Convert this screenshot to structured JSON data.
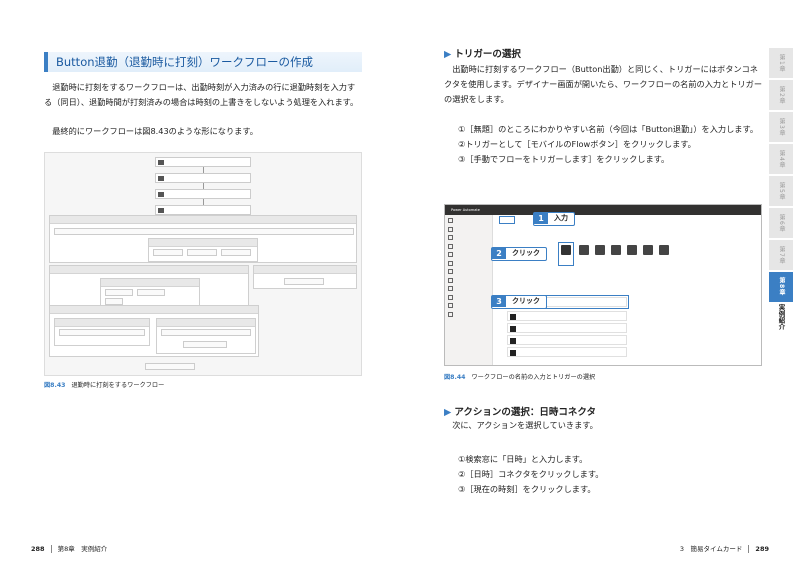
{
  "left": {
    "section_title": "Button退勤（退勤時に打刻）ワークフローの作成",
    "para1": "退勤時に打刻をするワークフローは、出勤時刻が入力済みの行に退勤時刻を入力する（同日）、退勤時間が打刻済みの場合は時刻の上書きをしないよう処理を入れます。",
    "para2": "最終的にワークフローは図8.43のような形になります。",
    "figure": {
      "number": "図8.43",
      "caption": "退勤時に打刻をするワークフロー"
    },
    "footer": {
      "page": "288",
      "chapter": "第8章　実例紹介"
    }
  },
  "right": {
    "heading_trigger": "トリガーの選択",
    "para_trigger": "出勤時に打刻するワークフロー（Button出勤）と同じく、トリガーにはボタンコネクタを使用します。デザイナー画面が開いたら、ワークフローの名前の入力とトリガーの選択をします。",
    "steps_trigger": [
      "①［無題］のところにわかりやすい名前（今回は「Button退勤」）を入力します。",
      "②トリガーとして［モバイルのFlowボタン］をクリックします。",
      "③［手動でフローをトリガーします］をクリックします。"
    ],
    "screenshot": {
      "app_title": "Power Automate",
      "callouts": [
        {
          "num": "1",
          "label": "入力"
        },
        {
          "num": "2",
          "label": "クリック"
        },
        {
          "num": "3",
          "label": "クリック"
        }
      ]
    },
    "figure": {
      "number": "図8.44",
      "caption": "ワークフローの名前の入力とトリガーの選択"
    },
    "heading_action": "アクションの選択：日時コネクタ",
    "para_action": "次に、アクションを選択していきます。",
    "steps_action": [
      "①検索窓に「日時」と入力します。",
      "②［日時］コネクタをクリックします。",
      "③［現在の時刻］をクリックします。"
    ],
    "footer": {
      "section": "3　簡易タイムカード",
      "page": "289"
    },
    "side_tabs": [
      "第1章",
      "第2章",
      "第3章",
      "第4章",
      "第5章",
      "第6章",
      "第7章",
      "第8章"
    ],
    "side_label": "実例紹介"
  }
}
